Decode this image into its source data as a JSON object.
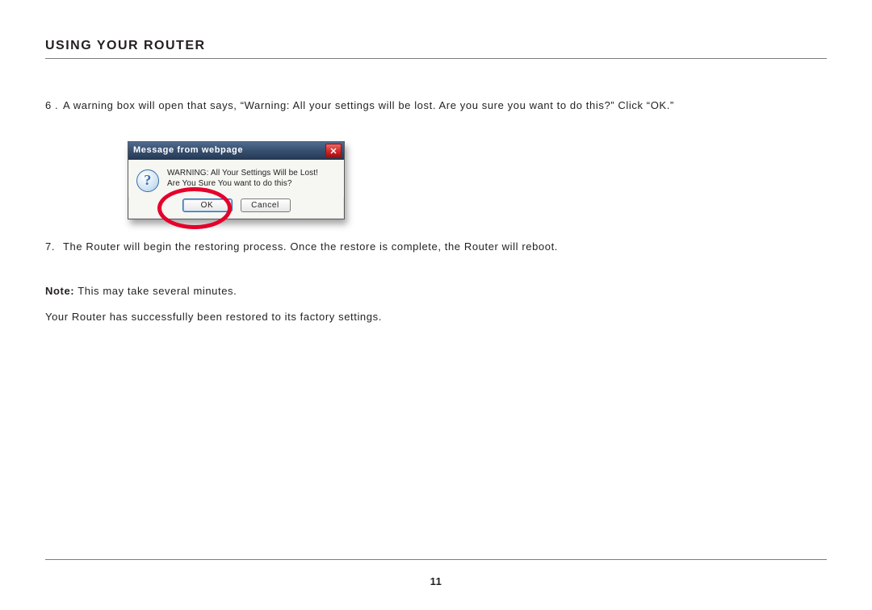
{
  "header": {
    "title": "USING YOUR ROUTER"
  },
  "steps": {
    "s6": {
      "num": "6 .",
      "text": "A warning box will open that says, “Warning: All your settings will be lost. Are you sure you want to do this?” Click “OK.”"
    },
    "s7": {
      "num": "7.",
      "text": "The Router will begin the restoring process. Once the restore is complete, the Router will reboot."
    }
  },
  "dialog": {
    "title": "Message from webpage",
    "icon_glyph": "?",
    "warning_line1": "WARNING: All Your Settings Will be Lost!",
    "warning_line2": "Are You Sure You want to do this?",
    "ok_label": "OK",
    "cancel_label": "Cancel"
  },
  "note": {
    "label": "Note:",
    "text": " This may take several minutes."
  },
  "conclusion": "Your Router has successfully been restored to its factory settings.",
  "page_number": "11"
}
